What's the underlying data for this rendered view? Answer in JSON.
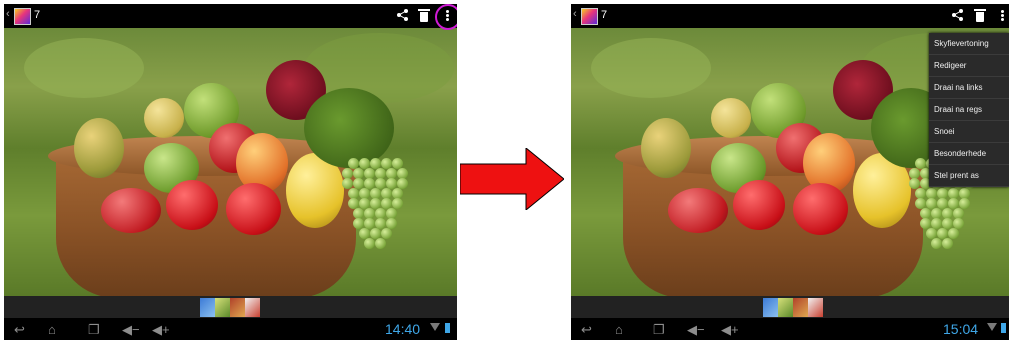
{
  "screens": [
    {
      "id": "before",
      "title": "7",
      "clock": "14:40",
      "menu_open": false
    },
    {
      "id": "after",
      "title": "7",
      "clock": "15:04",
      "menu_open": true,
      "menu_items": [
        {
          "label": "Skyfievertoning"
        },
        {
          "label": "Redigeer"
        },
        {
          "label": "Draai na links"
        },
        {
          "label": "Draai na regs"
        },
        {
          "label": "Snoei"
        },
        {
          "label": "Besonderhede"
        },
        {
          "label": "Stel prent as"
        }
      ]
    }
  ],
  "icons": {
    "back": "back-icon",
    "home": "home-icon",
    "recent": "recent-apps-icon",
    "volume_down": "volume-down-icon",
    "volume_up": "volume-up-icon",
    "share": "share-icon",
    "delete": "trash-icon",
    "overflow": "overflow-menu-icon"
  },
  "colors": {
    "highlight_ring": "#d01ad6",
    "arrow": "#ee1111",
    "clock": "#3fa7e8"
  }
}
